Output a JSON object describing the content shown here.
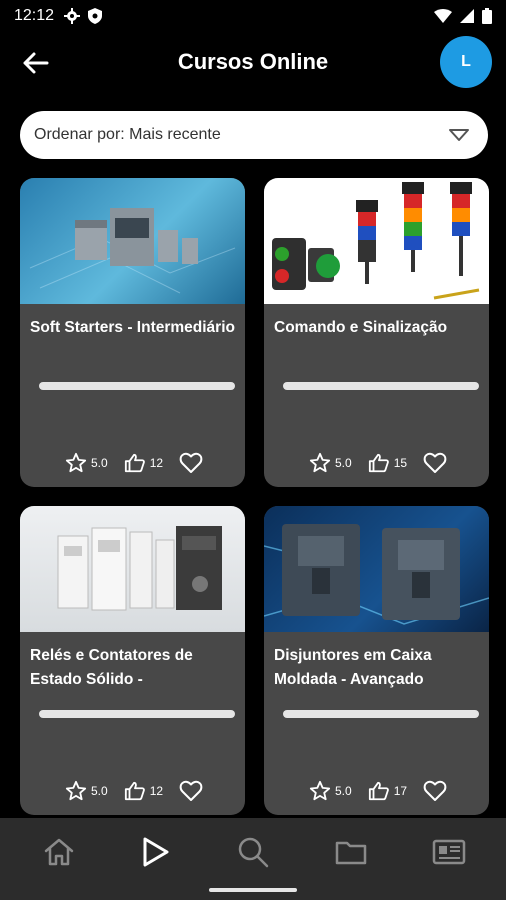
{
  "status_bar": {
    "time": "12:12"
  },
  "app_bar": {
    "title": "Cursos Online",
    "avatar_initial": "L"
  },
  "sort": {
    "label": "Ordenar por: Mais recente"
  },
  "courses": [
    {
      "title": "Soft Starters - Intermediário",
      "rating": "5.0",
      "likes": "12",
      "progress": 0
    },
    {
      "title": "Comando e Sinalização",
      "rating": "5.0",
      "likes": "15",
      "progress": 0
    },
    {
      "title": "Relés e Contatores de Estado Sólido -",
      "rating": "5.0",
      "likes": "12",
      "progress": 0
    },
    {
      "title": "Disjuntores em Caixa Moldada - Avançado",
      "rating": "5.0",
      "likes": "17",
      "progress": 0
    }
  ],
  "bottom_nav": [
    "home-icon",
    "play-icon",
    "search-icon",
    "folder-icon",
    "news-icon"
  ],
  "colors": {
    "accent": "#1e9be3",
    "card": "#484848",
    "nav": "#2c2c2c"
  }
}
